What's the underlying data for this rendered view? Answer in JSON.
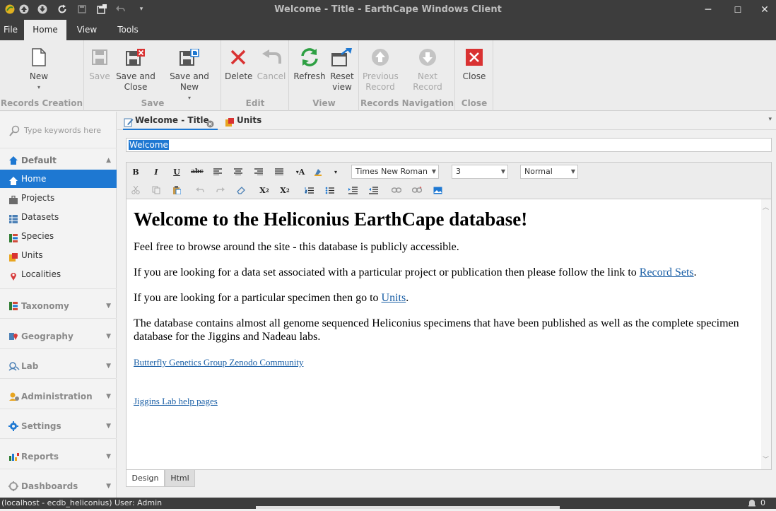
{
  "window": {
    "title": "Welcome - Title - EarthCape Windows Client",
    "minimize": "─",
    "maximize": "☐",
    "close": "✕"
  },
  "menu": {
    "tabs": [
      {
        "label": "File"
      },
      {
        "label": "Home"
      },
      {
        "label": "View"
      },
      {
        "label": "Tools"
      }
    ],
    "active": "Home"
  },
  "ribbon": {
    "groups": {
      "records_creation": "Records Creation",
      "save": "Save",
      "edit": "Edit",
      "view": "View",
      "records_navigation": "Records Navigation",
      "close": "Close"
    },
    "buttons": {
      "new": "New",
      "save": "Save",
      "save_and_close_1": "Save and",
      "save_and_close_2": "Close",
      "save_and_new": "Save and New",
      "delete": "Delete",
      "cancel": "Cancel",
      "refresh": "Refresh",
      "reset_view_1": "Reset",
      "reset_view_2": "view",
      "previous_record_1": "Previous",
      "previous_record_2": "Record",
      "next_record": "Next Record",
      "close": "Close"
    }
  },
  "sidebar": {
    "search_placeholder": "Type keywords here",
    "default_group": "Default",
    "items": [
      {
        "label": "Home",
        "icon": "home-icon",
        "color": "#1e78d2"
      },
      {
        "label": "Projects",
        "icon": "briefcase-icon",
        "color": "#6b6b6b"
      },
      {
        "label": "Datasets",
        "icon": "grid-icon",
        "color": "#4a7fb5"
      },
      {
        "label": "Species",
        "icon": "species-icon",
        "color": "#d14a3a"
      },
      {
        "label": "Units",
        "icon": "units-icon",
        "color": "#e8a520"
      },
      {
        "label": "Localities",
        "icon": "map-pin-icon",
        "color": "#d63b3b"
      }
    ],
    "groups": [
      {
        "label": "Taxonomy"
      },
      {
        "label": "Geography"
      },
      {
        "label": "Lab"
      },
      {
        "label": "Administration"
      },
      {
        "label": "Settings"
      },
      {
        "label": "Reports"
      },
      {
        "label": "Dashboards"
      }
    ]
  },
  "doc_tabs": [
    {
      "label": "Welcome - Title"
    },
    {
      "label": "Units"
    }
  ],
  "title_field": {
    "value": "Welcome"
  },
  "editor": {
    "font_name": "Times New Roman",
    "font_size": "3",
    "paragraph_style": "Normal",
    "heading": "Welcome to the Heliconius EarthCape database!",
    "p1": "Feel free to browse around the site - this database is publicly accessible.",
    "p2_text": "If you are looking for a data set associated with a particular project or publication then please follow the link to ",
    "p2_link": "Record Sets",
    "p2_end": ".",
    "p3_text": "If you are looking for a particular specimen then go to ",
    "p3_link": "Units",
    "p3_end": ".",
    "p4": "The database contains almost all genome sequenced Heliconius specimens that have been published as well as the complete specimen database for the Jiggins and Nadeau labs.",
    "link1": "Butterfly Genetics Group Zenodo Community",
    "link2": "Jiggins Lab help pages",
    "tabs": [
      {
        "label": "Design"
      },
      {
        "label": "Html"
      }
    ]
  },
  "status": {
    "connection": "(localhost - ecdb_heliconius)",
    "user": "User: Admin",
    "notifications": "0"
  },
  "colors": {
    "accent": "#1e78d2",
    "chrome": "#3d3d3d",
    "ribbon": "#ececec"
  }
}
